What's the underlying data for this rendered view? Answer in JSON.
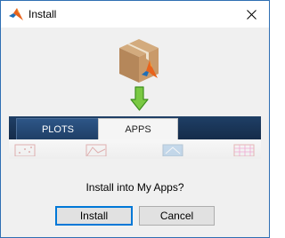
{
  "window": {
    "title": "Install"
  },
  "tabs": [
    {
      "label": "PLOTS"
    },
    {
      "label": "APPS"
    }
  ],
  "dialog": {
    "question": "Install into My Apps?",
    "install_label": "Install",
    "cancel_label": "Cancel"
  },
  "icons": {
    "app": "matlab-logo-icon",
    "close": "close-icon",
    "package": "package-box-icon",
    "arrow": "down-arrow-icon"
  },
  "colors": {
    "accent": "#0078d7",
    "tab_strip": "#1f3f66",
    "arrow_green": "#7ac943"
  }
}
